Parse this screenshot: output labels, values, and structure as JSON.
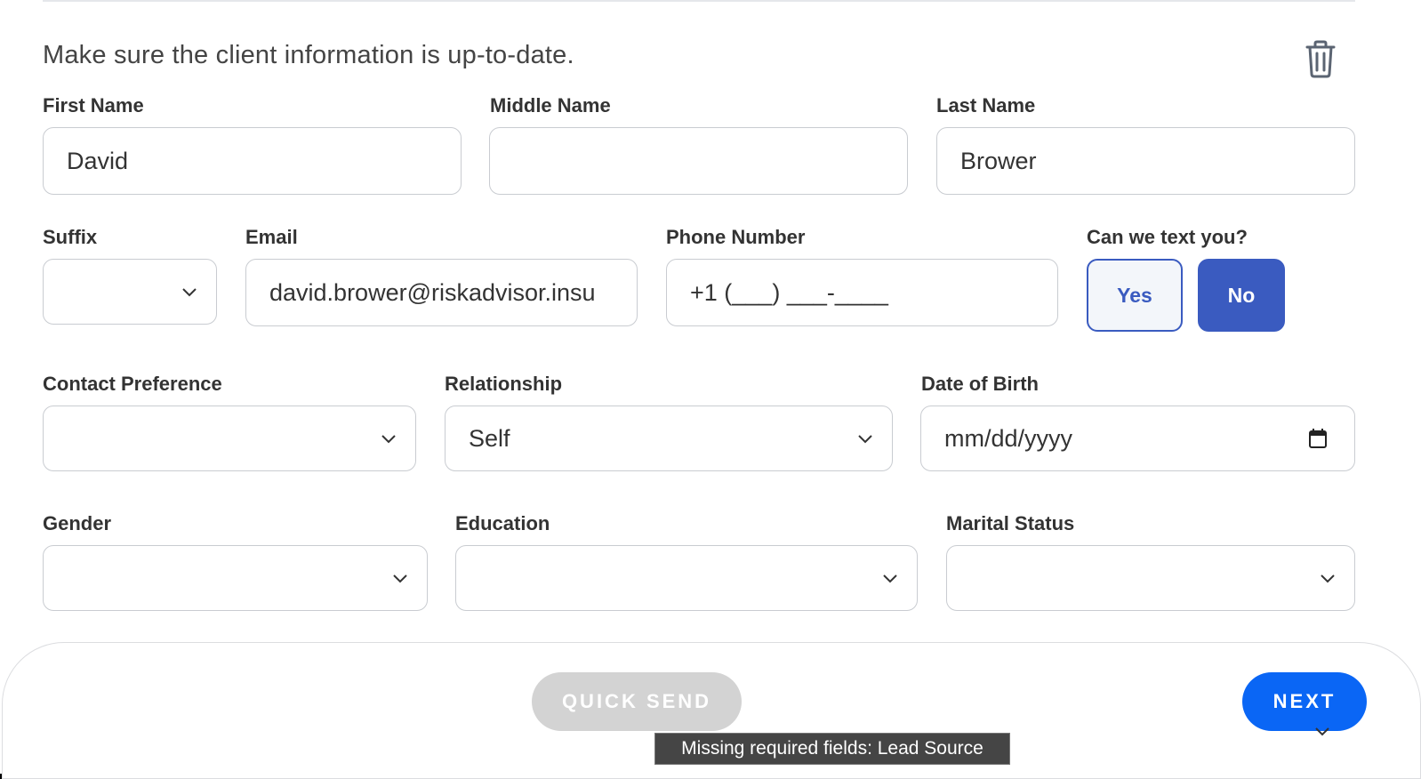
{
  "intro_text": "Make sure the client information is up-to-date.",
  "fields": {
    "first_name": {
      "label": "First Name",
      "value": "David"
    },
    "middle_name": {
      "label": "Middle Name",
      "value": ""
    },
    "last_name": {
      "label": "Last Name",
      "value": "Brower"
    },
    "suffix": {
      "label": "Suffix",
      "value": ""
    },
    "email": {
      "label": "Email",
      "value": "david.brower@riskadvisor.insu"
    },
    "phone": {
      "label": "Phone Number",
      "value": "+1 (___) ___-____"
    },
    "contact_preference": {
      "label": "Contact Preference",
      "value": ""
    },
    "relationship": {
      "label": "Relationship",
      "value": "Self"
    },
    "dob": {
      "label": "Date of Birth",
      "placeholder": "mm/dd/yyyy"
    },
    "gender": {
      "label": "Gender",
      "value": ""
    },
    "education": {
      "label": "Education",
      "value": ""
    },
    "marital_status": {
      "label": "Marital Status",
      "value": ""
    }
  },
  "text_opt_in": {
    "label": "Can we text you?",
    "yes_label": "Yes",
    "no_label": "No",
    "selected": "No"
  },
  "footer": {
    "quick_send_label": "QUICK SEND",
    "next_label": "NEXT",
    "tooltip": "Missing required fields: Lead Source"
  },
  "colors": {
    "accent": "#3a5bc0",
    "primary_button": "#0a66f5",
    "disabled_button": "#d3d3d3"
  },
  "icons": [
    "trash-icon",
    "chevron-down-icon",
    "calendar-icon"
  ]
}
